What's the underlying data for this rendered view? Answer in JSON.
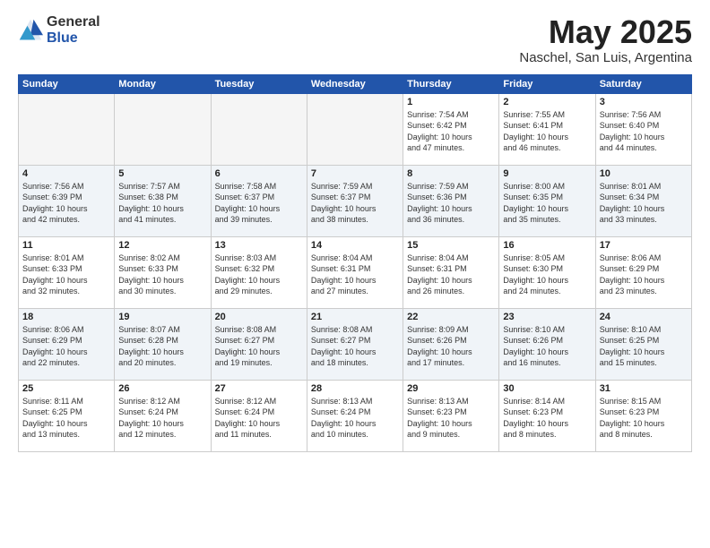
{
  "logo": {
    "general": "General",
    "blue": "Blue"
  },
  "header": {
    "title": "May 2025",
    "location": "Naschel, San Luis, Argentina"
  },
  "weekdays": [
    "Sunday",
    "Monday",
    "Tuesday",
    "Wednesday",
    "Thursday",
    "Friday",
    "Saturday"
  ],
  "weeks": [
    [
      {
        "day": "",
        "info": ""
      },
      {
        "day": "",
        "info": ""
      },
      {
        "day": "",
        "info": ""
      },
      {
        "day": "",
        "info": ""
      },
      {
        "day": "1",
        "info": "Sunrise: 7:54 AM\nSunset: 6:42 PM\nDaylight: 10 hours\nand 47 minutes."
      },
      {
        "day": "2",
        "info": "Sunrise: 7:55 AM\nSunset: 6:41 PM\nDaylight: 10 hours\nand 46 minutes."
      },
      {
        "day": "3",
        "info": "Sunrise: 7:56 AM\nSunset: 6:40 PM\nDaylight: 10 hours\nand 44 minutes."
      }
    ],
    [
      {
        "day": "4",
        "info": "Sunrise: 7:56 AM\nSunset: 6:39 PM\nDaylight: 10 hours\nand 42 minutes."
      },
      {
        "day": "5",
        "info": "Sunrise: 7:57 AM\nSunset: 6:38 PM\nDaylight: 10 hours\nand 41 minutes."
      },
      {
        "day": "6",
        "info": "Sunrise: 7:58 AM\nSunset: 6:37 PM\nDaylight: 10 hours\nand 39 minutes."
      },
      {
        "day": "7",
        "info": "Sunrise: 7:59 AM\nSunset: 6:37 PM\nDaylight: 10 hours\nand 38 minutes."
      },
      {
        "day": "8",
        "info": "Sunrise: 7:59 AM\nSunset: 6:36 PM\nDaylight: 10 hours\nand 36 minutes."
      },
      {
        "day": "9",
        "info": "Sunrise: 8:00 AM\nSunset: 6:35 PM\nDaylight: 10 hours\nand 35 minutes."
      },
      {
        "day": "10",
        "info": "Sunrise: 8:01 AM\nSunset: 6:34 PM\nDaylight: 10 hours\nand 33 minutes."
      }
    ],
    [
      {
        "day": "11",
        "info": "Sunrise: 8:01 AM\nSunset: 6:33 PM\nDaylight: 10 hours\nand 32 minutes."
      },
      {
        "day": "12",
        "info": "Sunrise: 8:02 AM\nSunset: 6:33 PM\nDaylight: 10 hours\nand 30 minutes."
      },
      {
        "day": "13",
        "info": "Sunrise: 8:03 AM\nSunset: 6:32 PM\nDaylight: 10 hours\nand 29 minutes."
      },
      {
        "day": "14",
        "info": "Sunrise: 8:04 AM\nSunset: 6:31 PM\nDaylight: 10 hours\nand 27 minutes."
      },
      {
        "day": "15",
        "info": "Sunrise: 8:04 AM\nSunset: 6:31 PM\nDaylight: 10 hours\nand 26 minutes."
      },
      {
        "day": "16",
        "info": "Sunrise: 8:05 AM\nSunset: 6:30 PM\nDaylight: 10 hours\nand 24 minutes."
      },
      {
        "day": "17",
        "info": "Sunrise: 8:06 AM\nSunset: 6:29 PM\nDaylight: 10 hours\nand 23 minutes."
      }
    ],
    [
      {
        "day": "18",
        "info": "Sunrise: 8:06 AM\nSunset: 6:29 PM\nDaylight: 10 hours\nand 22 minutes."
      },
      {
        "day": "19",
        "info": "Sunrise: 8:07 AM\nSunset: 6:28 PM\nDaylight: 10 hours\nand 20 minutes."
      },
      {
        "day": "20",
        "info": "Sunrise: 8:08 AM\nSunset: 6:27 PM\nDaylight: 10 hours\nand 19 minutes."
      },
      {
        "day": "21",
        "info": "Sunrise: 8:08 AM\nSunset: 6:27 PM\nDaylight: 10 hours\nand 18 minutes."
      },
      {
        "day": "22",
        "info": "Sunrise: 8:09 AM\nSunset: 6:26 PM\nDaylight: 10 hours\nand 17 minutes."
      },
      {
        "day": "23",
        "info": "Sunrise: 8:10 AM\nSunset: 6:26 PM\nDaylight: 10 hours\nand 16 minutes."
      },
      {
        "day": "24",
        "info": "Sunrise: 8:10 AM\nSunset: 6:25 PM\nDaylight: 10 hours\nand 15 minutes."
      }
    ],
    [
      {
        "day": "25",
        "info": "Sunrise: 8:11 AM\nSunset: 6:25 PM\nDaylight: 10 hours\nand 13 minutes."
      },
      {
        "day": "26",
        "info": "Sunrise: 8:12 AM\nSunset: 6:24 PM\nDaylight: 10 hours\nand 12 minutes."
      },
      {
        "day": "27",
        "info": "Sunrise: 8:12 AM\nSunset: 6:24 PM\nDaylight: 10 hours\nand 11 minutes."
      },
      {
        "day": "28",
        "info": "Sunrise: 8:13 AM\nSunset: 6:24 PM\nDaylight: 10 hours\nand 10 minutes."
      },
      {
        "day": "29",
        "info": "Sunrise: 8:13 AM\nSunset: 6:23 PM\nDaylight: 10 hours\nand 9 minutes."
      },
      {
        "day": "30",
        "info": "Sunrise: 8:14 AM\nSunset: 6:23 PM\nDaylight: 10 hours\nand 8 minutes."
      },
      {
        "day": "31",
        "info": "Sunrise: 8:15 AM\nSunset: 6:23 PM\nDaylight: 10 hours\nand 8 minutes."
      }
    ]
  ]
}
